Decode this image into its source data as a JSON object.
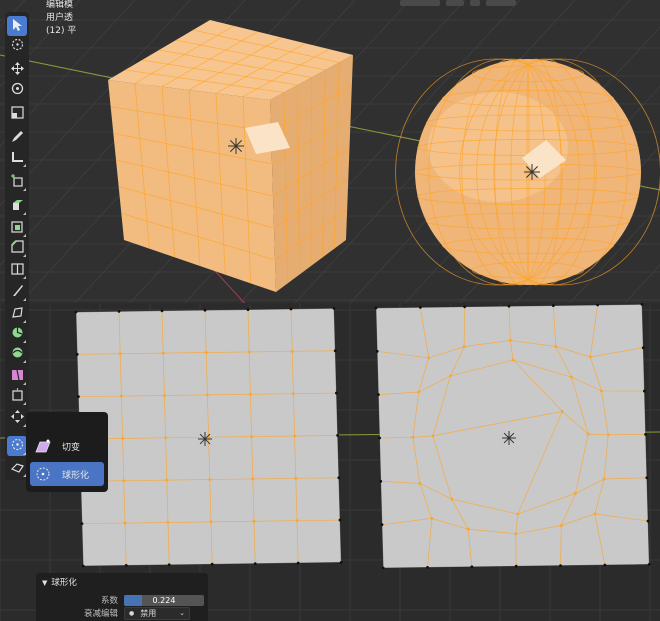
{
  "header": {
    "view_label": "用户透",
    "object_label": "(12) 平",
    "mode_label": "编辑模"
  },
  "toolbar": {
    "tools": [
      {
        "name": "select-box-tool",
        "icon": "cursor-box-icon",
        "active": true
      },
      {
        "name": "cursor-tool",
        "icon": "crosshair-circle-icon"
      },
      {
        "name": "move-tool",
        "icon": "move-arrows-icon"
      },
      {
        "name": "rotate-tool",
        "icon": "rotate-icon"
      },
      {
        "name": "scale-tool",
        "icon": "scale-icon"
      },
      {
        "name": "annotate-tool",
        "icon": "pencil-icon"
      },
      {
        "name": "measure-tool",
        "icon": "ruler-angle-icon"
      },
      {
        "name": "add-cube-tool",
        "icon": "add-cube-icon"
      },
      {
        "name": "extrude-tool",
        "icon": "extrude-icon"
      },
      {
        "name": "inset-tool",
        "icon": "inset-icon"
      },
      {
        "name": "bevel-tool",
        "icon": "bevel-icon"
      },
      {
        "name": "loop-cut-tool",
        "icon": "loop-cut-icon"
      },
      {
        "name": "knife-tool",
        "icon": "knife-icon"
      },
      {
        "name": "poly-build-tool",
        "icon": "poly-build-icon"
      },
      {
        "name": "spin-tool",
        "icon": "spin-icon"
      },
      {
        "name": "smooth-tool",
        "icon": "smooth-icon"
      },
      {
        "name": "edge-slide-tool",
        "icon": "edge-slide-icon"
      },
      {
        "name": "shrink-fatten-tool",
        "icon": "shrink-fatten-icon"
      },
      {
        "name": "push-pull-tool",
        "icon": "push-pull-icon"
      },
      {
        "name": "to-sphere-tool",
        "icon": "to-sphere-icon",
        "active": true
      },
      {
        "name": "rip-tool",
        "icon": "rip-icon"
      }
    ]
  },
  "flyout": {
    "items": [
      {
        "label": "切变",
        "icon": "shear-icon",
        "selected": false
      },
      {
        "label": "球形化",
        "icon": "to-sphere-icon",
        "selected": true
      }
    ]
  },
  "operator_panel": {
    "title": "球形化",
    "factor_label": "系数",
    "factor_value": "0.224",
    "factor": 0.224,
    "proportional_label": "衰减编辑",
    "proportional_value": "禁用"
  },
  "colors": {
    "background": "#303030",
    "mesh_orange": "#f0b87c",
    "select_orange": "#ffa424",
    "plane_grey": "#c9c9c9",
    "active_blue": "#4b7bd1"
  }
}
